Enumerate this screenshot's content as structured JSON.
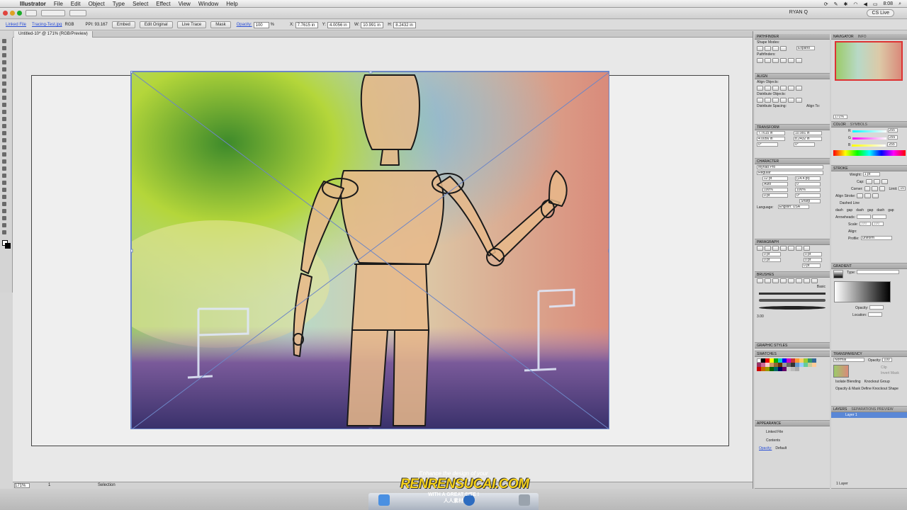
{
  "menubar": {
    "app_name": "Illustrator",
    "menus": [
      "File",
      "Edit",
      "Object",
      "Type",
      "Select",
      "Effect",
      "View",
      "Window",
      "Help"
    ],
    "clock": "8:08",
    "right_icons": [
      "sync-icon",
      "pen-icon",
      "bluetooth-icon",
      "wifi-icon",
      "volume-icon",
      "battery-icon",
      "spotlight-icon"
    ]
  },
  "appbar": {
    "user": "RYAN Q",
    "cs_live": "CS Live"
  },
  "control_bar": {
    "linked_file_label": "Linked File",
    "file_name": "Tracing-Test.jpg",
    "color_mode": "RGB",
    "ppi": "PPI: 93.167",
    "embed_label": "Embed",
    "edit_original_label": "Edit Original",
    "live_trace_label": "Live Trace",
    "mask_label": "Mask",
    "opacity_label": "Opacity:",
    "opacity_value": "100",
    "opacity_unit": "%",
    "x_label": "X:",
    "x_value": "7.7615 in",
    "y_label": "Y:",
    "y_value": "4.0056 in",
    "w_label": "W:",
    "w_value": "10.991 in",
    "h_label": "H:",
    "h_value": "8.2432 in"
  },
  "document_tab": {
    "title": "Untitled-10* @ 171% (RGB/Preview)"
  },
  "status_bar": {
    "zoom": "171%",
    "page": "1",
    "tool": "Selection"
  },
  "watermark": {
    "line1": "Enhance the design of your",
    "line2": "RENRENSUCAI.COM",
    "line3": "WITH A GREAT SITE !",
    "line4": "人人素材"
  },
  "panels": {
    "pathfinder": {
      "title": "PATHFINDER",
      "shape_modes": "Shape Modes:",
      "expand": "Expand",
      "pathfinders": "Pathfinders:"
    },
    "align": {
      "title": "ALIGN",
      "align_objects": "Align Objects:",
      "distribute_objects": "Distribute Objects:",
      "distribute_spacing": "Distribute Spacing:",
      "align_to": "Align To:"
    },
    "transform": {
      "title": "TRANSFORM",
      "x": "7.7615 in",
      "y": "4.0056 in",
      "w": "10.991 in",
      "h": "8.2432 in",
      "rot": "0°",
      "shear": "0°"
    },
    "character": {
      "title": "CHARACTER",
      "font": "Myriad Pro",
      "style": "Regular",
      "size": "12 pt",
      "leading": "(14.4 pt)",
      "kerning": "Auto",
      "tracking": "0",
      "hscale": "100%",
      "vscale": "100%",
      "baseline": "0 pt",
      "rotation": "0°",
      "aa": "Sharp",
      "language_label": "Language:",
      "language": "English: USA"
    },
    "paragraph": {
      "title": "PARAGRAPH",
      "indent1": "0 pt",
      "indent2": "0 pt",
      "indent3": "0 pt",
      "space1": "0 pt",
      "space2": "0 pt"
    },
    "brushes": {
      "title": "BRUSHES",
      "basic": "Basic",
      "size": "3.00"
    },
    "graphic_styles": {
      "title": "GRAPHIC STYLES"
    },
    "swatches": {
      "title": "SWATCHES"
    },
    "appearance": {
      "title": "APPEARANCE",
      "linked_file": "Linked File",
      "contents": "Contents",
      "opacity": "Opacity:",
      "opacity_value": "Default"
    },
    "navigator": {
      "title": "NAVIGATOR",
      "tab2": "INFO",
      "zoom": "171%"
    },
    "color": {
      "title": "COLOR",
      "tab2": "SYMBOLS",
      "r_label": "R",
      "r": "255",
      "g_label": "G",
      "g": "255",
      "b_label": "B",
      "b": "255"
    },
    "stroke": {
      "title": "STROKE",
      "weight_label": "Weight:",
      "weight": "1 pt",
      "cap": "Cap:",
      "corner": "Corner:",
      "limit_label": "Limit:",
      "limit": "10",
      "align_stroke": "Align Stroke:",
      "dashed_line": "Dashed Line",
      "dash_labels": [
        "dash",
        "gap",
        "dash",
        "gap",
        "dash",
        "gap"
      ],
      "arrowheads": "Arrowheads:",
      "scale": "Scale:",
      "scale1": "100",
      "scale2": "100",
      "align": "Align:",
      "profile": "Profile:",
      "profile_value": "Uniform"
    },
    "gradient": {
      "title": "GRADIENT",
      "type_label": "Type:",
      "opacity": "Opacity:",
      "location": "Location:"
    },
    "transparency": {
      "title": "TRANSPARENCY",
      "mode": "Normal",
      "opacity_label": "Opacity:",
      "opacity": "100",
      "clip": "Clip",
      "invert_mask": "Invert Mask",
      "isolate_blending": "Isolate Blending",
      "knockout_group": "Knockout Group",
      "opacity_mask": "Opacity & Mask Define Knockout Shape"
    },
    "layers": {
      "title": "LAYERS",
      "tab2": "SEPARATIONS PREVIEW",
      "layer_name": "Layer 1",
      "count": "1 Layer"
    }
  },
  "colors": {
    "selection": "#6d86c6",
    "layer_highlight": "#5a87d6"
  }
}
